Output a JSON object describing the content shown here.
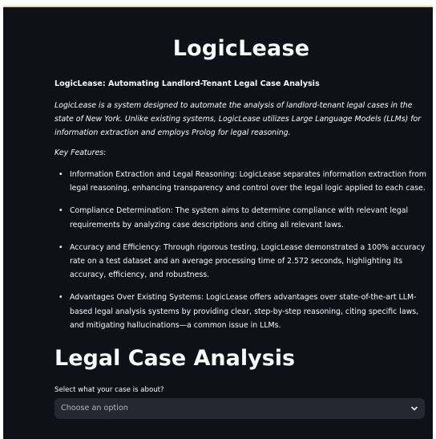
{
  "app": {
    "title": "LogicLease",
    "subtitle": "LogicLease: Automating Landlord-Tenant Legal Case Analysis",
    "intro": "LogicLease is a system designed to automate the analysis of landlord-tenant legal cases in the state of New York. Unlike existing systems, LogicLease utilizes Large Language Models (LLMs) for information extraction and employs Prolog for legal reasoning.",
    "key_features_label": "Key Features:",
    "features": [
      "Information Extraction and Legal Reasoning: LogicLease separates information extraction from legal reasoning, enhancing transparency and control over the legal logic applied to each case.",
      "Compliance Determination: The system aims to determine compliance with relevant legal requirements by analyzing case descriptions and citing all relevant laws.",
      "Accuracy and Efficiency: Through rigorous testing, LogicLease demonstrated a 100% accuracy rate on a test dataset and an average processing time of 2.572 seconds, highlighting its accuracy, efficiency, and robustness.",
      "Advantages Over Existing Systems: LogicLease offers advantages over state-of-the-art LLM-based legal analysis systems by providing clear, step-by-step reasoning, citing specific laws, and mitigating hallucinations—a common issue in LLMs."
    ],
    "bullet": "•"
  },
  "analysis": {
    "heading": "Legal Case Analysis",
    "select_label": "Select what your case is about?",
    "select_value": "Choose an option",
    "select_icon": "chevron-down-icon"
  },
  "colors": {
    "background": "#0e1117",
    "text": "#fafafa",
    "select_bg": "#262730",
    "select_text": "#b0b3bc",
    "top_decoration": "#e8d9b0"
  }
}
